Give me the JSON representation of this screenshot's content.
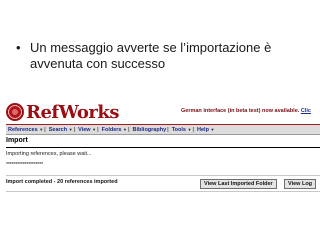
{
  "slide": {
    "bullet_symbol": "•",
    "bullet_text": "Un messaggio avverte se l’importazione è avvenuta con successo"
  },
  "refworks": {
    "logo_text": "RefWorks",
    "banner_text": "German interface (in beta test) now available.",
    "banner_link": "Clic",
    "menu": [
      {
        "label": "References",
        "has_caret": true
      },
      {
        "label": "Search",
        "has_caret": true
      },
      {
        "label": "View",
        "has_caret": true
      },
      {
        "label": "Folders",
        "has_caret": true
      },
      {
        "label": "Bibliography",
        "has_caret": false
      },
      {
        "label": "Tools",
        "has_caret": true
      },
      {
        "label": "Help",
        "has_caret": true
      }
    ],
    "caret": "▼",
    "page_title": "Import",
    "status_importing": "Importing references, please wait...",
    "stars": "********************",
    "status_completed": "Import completed - 20 references imported",
    "button_last_folder": "View Last Imported Folder",
    "button_view_log": "View Log",
    "colors": {
      "brand_red": "#9a0d12",
      "menu_blue": "#1a2a80",
      "menu_bg": "#dcdcdc"
    }
  }
}
